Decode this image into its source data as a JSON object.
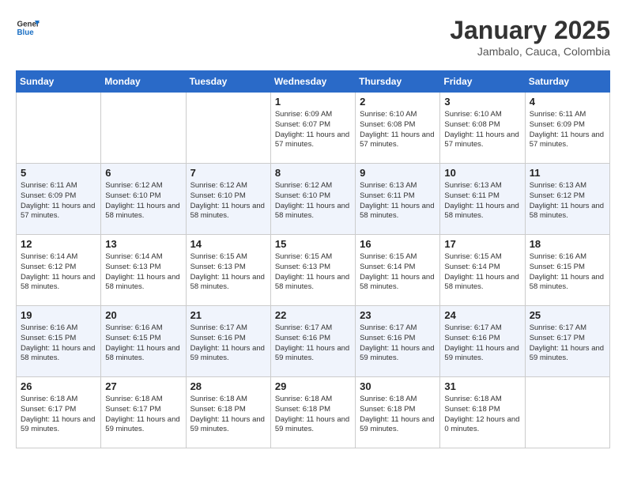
{
  "header": {
    "logo_general": "General",
    "logo_blue": "Blue",
    "month": "January 2025",
    "location": "Jambalo, Cauca, Colombia"
  },
  "weekdays": [
    "Sunday",
    "Monday",
    "Tuesday",
    "Wednesday",
    "Thursday",
    "Friday",
    "Saturday"
  ],
  "weeks": [
    [
      {
        "day": "",
        "sunrise": "",
        "sunset": "",
        "daylight": ""
      },
      {
        "day": "",
        "sunrise": "",
        "sunset": "",
        "daylight": ""
      },
      {
        "day": "",
        "sunrise": "",
        "sunset": "",
        "daylight": ""
      },
      {
        "day": "1",
        "sunrise": "Sunrise: 6:09 AM",
        "sunset": "Sunset: 6:07 PM",
        "daylight": "Daylight: 11 hours and 57 minutes."
      },
      {
        "day": "2",
        "sunrise": "Sunrise: 6:10 AM",
        "sunset": "Sunset: 6:08 PM",
        "daylight": "Daylight: 11 hours and 57 minutes."
      },
      {
        "day": "3",
        "sunrise": "Sunrise: 6:10 AM",
        "sunset": "Sunset: 6:08 PM",
        "daylight": "Daylight: 11 hours and 57 minutes."
      },
      {
        "day": "4",
        "sunrise": "Sunrise: 6:11 AM",
        "sunset": "Sunset: 6:09 PM",
        "daylight": "Daylight: 11 hours and 57 minutes."
      }
    ],
    [
      {
        "day": "5",
        "sunrise": "Sunrise: 6:11 AM",
        "sunset": "Sunset: 6:09 PM",
        "daylight": "Daylight: 11 hours and 57 minutes."
      },
      {
        "day": "6",
        "sunrise": "Sunrise: 6:12 AM",
        "sunset": "Sunset: 6:10 PM",
        "daylight": "Daylight: 11 hours and 58 minutes."
      },
      {
        "day": "7",
        "sunrise": "Sunrise: 6:12 AM",
        "sunset": "Sunset: 6:10 PM",
        "daylight": "Daylight: 11 hours and 58 minutes."
      },
      {
        "day": "8",
        "sunrise": "Sunrise: 6:12 AM",
        "sunset": "Sunset: 6:10 PM",
        "daylight": "Daylight: 11 hours and 58 minutes."
      },
      {
        "day": "9",
        "sunrise": "Sunrise: 6:13 AM",
        "sunset": "Sunset: 6:11 PM",
        "daylight": "Daylight: 11 hours and 58 minutes."
      },
      {
        "day": "10",
        "sunrise": "Sunrise: 6:13 AM",
        "sunset": "Sunset: 6:11 PM",
        "daylight": "Daylight: 11 hours and 58 minutes."
      },
      {
        "day": "11",
        "sunrise": "Sunrise: 6:13 AM",
        "sunset": "Sunset: 6:12 PM",
        "daylight": "Daylight: 11 hours and 58 minutes."
      }
    ],
    [
      {
        "day": "12",
        "sunrise": "Sunrise: 6:14 AM",
        "sunset": "Sunset: 6:12 PM",
        "daylight": "Daylight: 11 hours and 58 minutes."
      },
      {
        "day": "13",
        "sunrise": "Sunrise: 6:14 AM",
        "sunset": "Sunset: 6:13 PM",
        "daylight": "Daylight: 11 hours and 58 minutes."
      },
      {
        "day": "14",
        "sunrise": "Sunrise: 6:15 AM",
        "sunset": "Sunset: 6:13 PM",
        "daylight": "Daylight: 11 hours and 58 minutes."
      },
      {
        "day": "15",
        "sunrise": "Sunrise: 6:15 AM",
        "sunset": "Sunset: 6:13 PM",
        "daylight": "Daylight: 11 hours and 58 minutes."
      },
      {
        "day": "16",
        "sunrise": "Sunrise: 6:15 AM",
        "sunset": "Sunset: 6:14 PM",
        "daylight": "Daylight: 11 hours and 58 minutes."
      },
      {
        "day": "17",
        "sunrise": "Sunrise: 6:15 AM",
        "sunset": "Sunset: 6:14 PM",
        "daylight": "Daylight: 11 hours and 58 minutes."
      },
      {
        "day": "18",
        "sunrise": "Sunrise: 6:16 AM",
        "sunset": "Sunset: 6:15 PM",
        "daylight": "Daylight: 11 hours and 58 minutes."
      }
    ],
    [
      {
        "day": "19",
        "sunrise": "Sunrise: 6:16 AM",
        "sunset": "Sunset: 6:15 PM",
        "daylight": "Daylight: 11 hours and 58 minutes."
      },
      {
        "day": "20",
        "sunrise": "Sunrise: 6:16 AM",
        "sunset": "Sunset: 6:15 PM",
        "daylight": "Daylight: 11 hours and 58 minutes."
      },
      {
        "day": "21",
        "sunrise": "Sunrise: 6:17 AM",
        "sunset": "Sunset: 6:16 PM",
        "daylight": "Daylight: 11 hours and 59 minutes."
      },
      {
        "day": "22",
        "sunrise": "Sunrise: 6:17 AM",
        "sunset": "Sunset: 6:16 PM",
        "daylight": "Daylight: 11 hours and 59 minutes."
      },
      {
        "day": "23",
        "sunrise": "Sunrise: 6:17 AM",
        "sunset": "Sunset: 6:16 PM",
        "daylight": "Daylight: 11 hours and 59 minutes."
      },
      {
        "day": "24",
        "sunrise": "Sunrise: 6:17 AM",
        "sunset": "Sunset: 6:16 PM",
        "daylight": "Daylight: 11 hours and 59 minutes."
      },
      {
        "day": "25",
        "sunrise": "Sunrise: 6:17 AM",
        "sunset": "Sunset: 6:17 PM",
        "daylight": "Daylight: 11 hours and 59 minutes."
      }
    ],
    [
      {
        "day": "26",
        "sunrise": "Sunrise: 6:18 AM",
        "sunset": "Sunset: 6:17 PM",
        "daylight": "Daylight: 11 hours and 59 minutes."
      },
      {
        "day": "27",
        "sunrise": "Sunrise: 6:18 AM",
        "sunset": "Sunset: 6:17 PM",
        "daylight": "Daylight: 11 hours and 59 minutes."
      },
      {
        "day": "28",
        "sunrise": "Sunrise: 6:18 AM",
        "sunset": "Sunset: 6:18 PM",
        "daylight": "Daylight: 11 hours and 59 minutes."
      },
      {
        "day": "29",
        "sunrise": "Sunrise: 6:18 AM",
        "sunset": "Sunset: 6:18 PM",
        "daylight": "Daylight: 11 hours and 59 minutes."
      },
      {
        "day": "30",
        "sunrise": "Sunrise: 6:18 AM",
        "sunset": "Sunset: 6:18 PM",
        "daylight": "Daylight: 11 hours and 59 minutes."
      },
      {
        "day": "31",
        "sunrise": "Sunrise: 6:18 AM",
        "sunset": "Sunset: 6:18 PM",
        "daylight": "Daylight: 12 hours and 0 minutes."
      },
      {
        "day": "",
        "sunrise": "",
        "sunset": "",
        "daylight": ""
      }
    ]
  ]
}
